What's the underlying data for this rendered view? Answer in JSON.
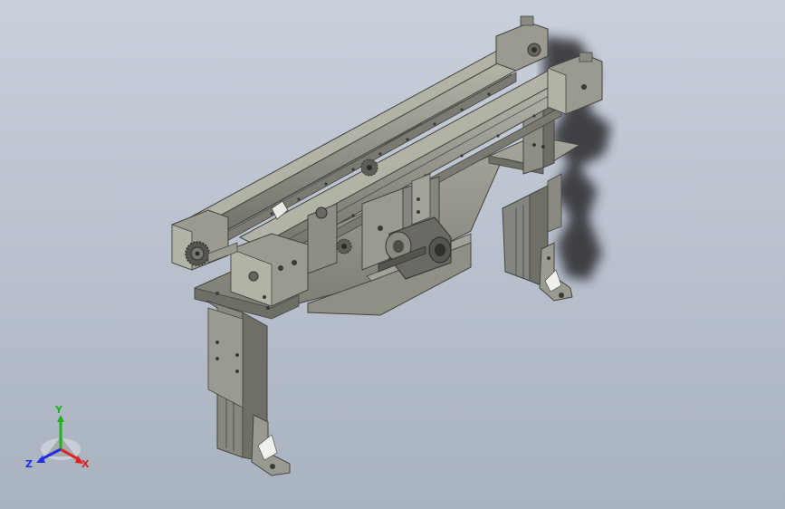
{
  "viewport": {
    "background_top": "#c9d0dc",
    "background_bottom": "#a9b2bf",
    "model": {
      "part_color": "#8d8d84",
      "part_dark": "#55554f",
      "part_light": "#b5b5aa",
      "shadow_color": "#2a2a2e"
    }
  },
  "triad": {
    "x_label": "X",
    "y_label": "Y",
    "z_label": "Z",
    "x_color": "#e02020",
    "y_color": "#20b020",
    "z_color": "#2030e0"
  }
}
